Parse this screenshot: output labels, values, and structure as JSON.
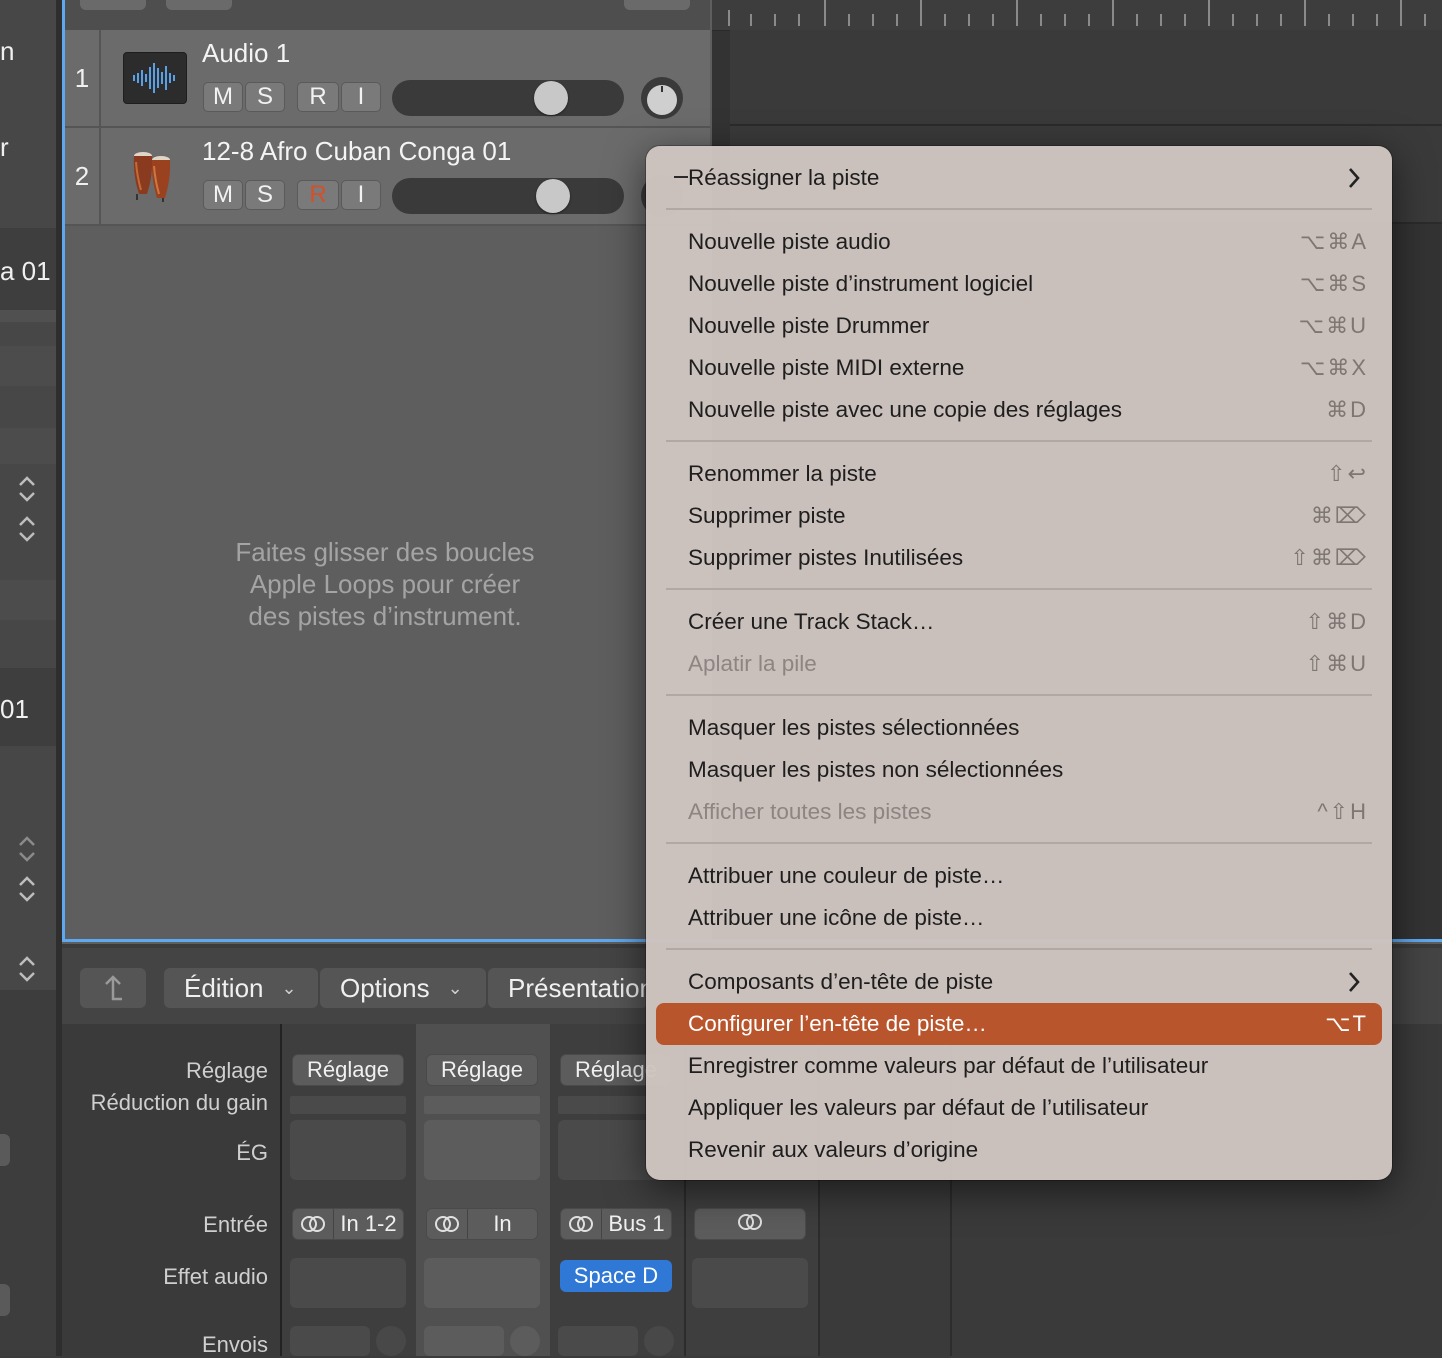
{
  "left_panel": {
    "fragments": [
      "n",
      "r",
      "a 01",
      "01"
    ]
  },
  "tracks": [
    {
      "number": "1",
      "name": "Audio 1",
      "icon": "audio-waveform-icon",
      "buttons": [
        "M",
        "S",
        "R",
        "I"
      ],
      "record_armed": false
    },
    {
      "number": "2",
      "name": "12-8 Afro Cuban Conga 01",
      "icon": "conga-drum-icon",
      "buttons": [
        "M",
        "S",
        "R",
        "I"
      ],
      "record_armed": true
    }
  ],
  "empty_hint": [
    "Faites glisser des boucles",
    "Apple Loops pour créer",
    "des pistes d’instrument."
  ],
  "mixer": {
    "toolbar": {
      "back_icon": "up-arrow-icon",
      "menus": [
        "Édition",
        "Options",
        "Présentation"
      ]
    },
    "row_labels": {
      "setting": "Réglage",
      "gain_reduction": "Réduction du gain",
      "eq": "ÉG",
      "input": "Entrée",
      "audio_fx": "Effet audio",
      "sends": "Envois"
    },
    "strips": [
      {
        "setting": "Réglage",
        "input": "In 1-2",
        "effect": ""
      },
      {
        "setting": "Réglage",
        "input": "In",
        "effect": ""
      },
      {
        "setting": "Réglage",
        "input": "Bus 1",
        "effect": "Space D"
      },
      {
        "setting": "",
        "input": "",
        "effect": ""
      }
    ]
  },
  "context_menu": {
    "header": {
      "label": "Réassigner la piste",
      "has_submenu": true
    },
    "groups": [
      [
        {
          "label": "Nouvelle piste audio",
          "shortcut": "⌥⌘A"
        },
        {
          "label": "Nouvelle piste d’instrument logiciel",
          "shortcut": "⌥⌘S"
        },
        {
          "label": "Nouvelle piste Drummer",
          "shortcut": "⌥⌘U"
        },
        {
          "label": "Nouvelle piste MIDI externe",
          "shortcut": "⌥⌘X"
        },
        {
          "label": "Nouvelle piste avec une copie des réglages",
          "shortcut": "⌘D"
        }
      ],
      [
        {
          "label": "Renommer la piste",
          "shortcut": "⇧↩"
        },
        {
          "label": "Supprimer piste",
          "shortcut": "⌘⌦"
        },
        {
          "label": "Supprimer pistes Inutilisées",
          "shortcut": "⇧⌘⌦"
        }
      ],
      [
        {
          "label": "Créer une Track Stack…",
          "shortcut": "⇧⌘D"
        },
        {
          "label": "Aplatir la pile",
          "shortcut": "⇧⌘U",
          "disabled": true
        }
      ],
      [
        {
          "label": "Masquer les pistes sélectionnées",
          "shortcut": ""
        },
        {
          "label": "Masquer les pistes non sélectionnées",
          "shortcut": ""
        },
        {
          "label": "Afficher toutes les pistes",
          "shortcut": "^⇧H",
          "disabled": true
        }
      ],
      [
        {
          "label": "Attribuer une couleur de piste…",
          "shortcut": ""
        },
        {
          "label": "Attribuer une icône de piste…",
          "shortcut": ""
        }
      ],
      [
        {
          "label": "Composants d’en-tête de piste",
          "shortcut": "",
          "has_submenu": true
        },
        {
          "label": "Configurer l’en-tête de piste…",
          "shortcut": "⌥T",
          "highlighted": true
        },
        {
          "label": "Enregistrer comme valeurs par défaut de l’utilisateur",
          "shortcut": ""
        },
        {
          "label": "Appliquer les valeurs par défaut de l’utilisateur",
          "shortcut": ""
        },
        {
          "label": "Revenir aux valeurs d’origine",
          "shortcut": ""
        }
      ]
    ]
  },
  "colors": {
    "highlight": "#b9552d",
    "record_active": "#d2502a",
    "selection_border": "#5ea8f0",
    "effect_slot": "#2f78d6"
  }
}
